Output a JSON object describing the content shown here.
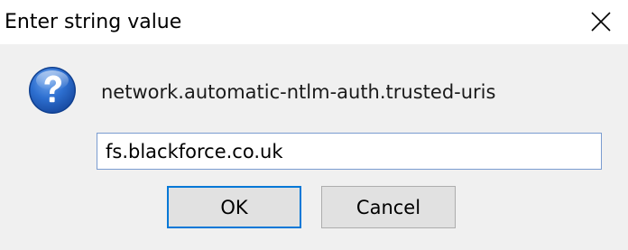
{
  "window": {
    "title": "Enter string value",
    "close_icon": "close-icon"
  },
  "prompt": {
    "icon": "question-icon",
    "preference_name": "network.automatic-ntlm-auth.trusted-uris"
  },
  "input": {
    "value": "fs.blackforce.co.uk"
  },
  "buttons": {
    "ok_label": "OK",
    "cancel_label": "Cancel"
  },
  "colors": {
    "background": "#f0f0f0",
    "titlebar": "#ffffff",
    "focus_border": "#0078d7",
    "button_face": "#e1e1e1",
    "icon_blue": "#1f5fc2"
  }
}
